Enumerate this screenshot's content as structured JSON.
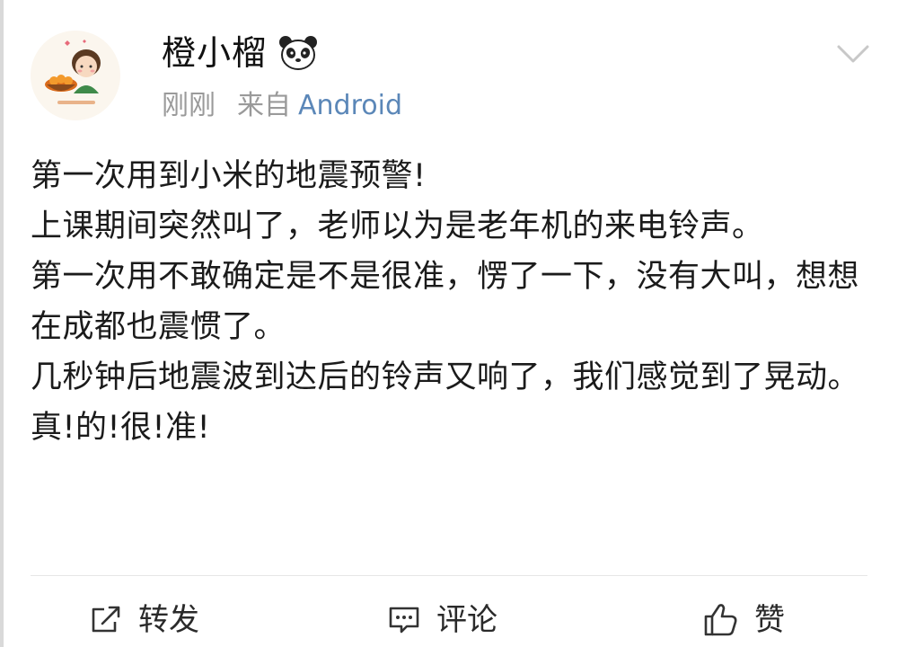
{
  "post": {
    "author": "橙小榴",
    "time": "刚刚",
    "via": "来自",
    "device": "Android",
    "lines": [
      "第一次用到小米的地震预警!",
      "上课期间突然叫了，老师以为是老年机的来电铃声。",
      "第一次用不敢确定是不是很准，愣了一下，没有大叫，想想在成都也震惯了。",
      "几秒钟后地震波到达后的铃声又响了，我们感觉到了晃动。",
      "真!的!很!准!"
    ]
  },
  "actions": {
    "repost": "转发",
    "comment": "评论",
    "like": "赞"
  },
  "colors": {
    "device_link": "#5b87b8",
    "meta": "#9a9a9a",
    "text": "#1b1b1b"
  },
  "icons": {
    "avatar": "cartoon-girl-avatar",
    "badge": "panda-icon",
    "menu": "chevron-down-icon",
    "repost": "share-icon",
    "comment": "comment-icon",
    "like": "thumbs-up-icon"
  }
}
